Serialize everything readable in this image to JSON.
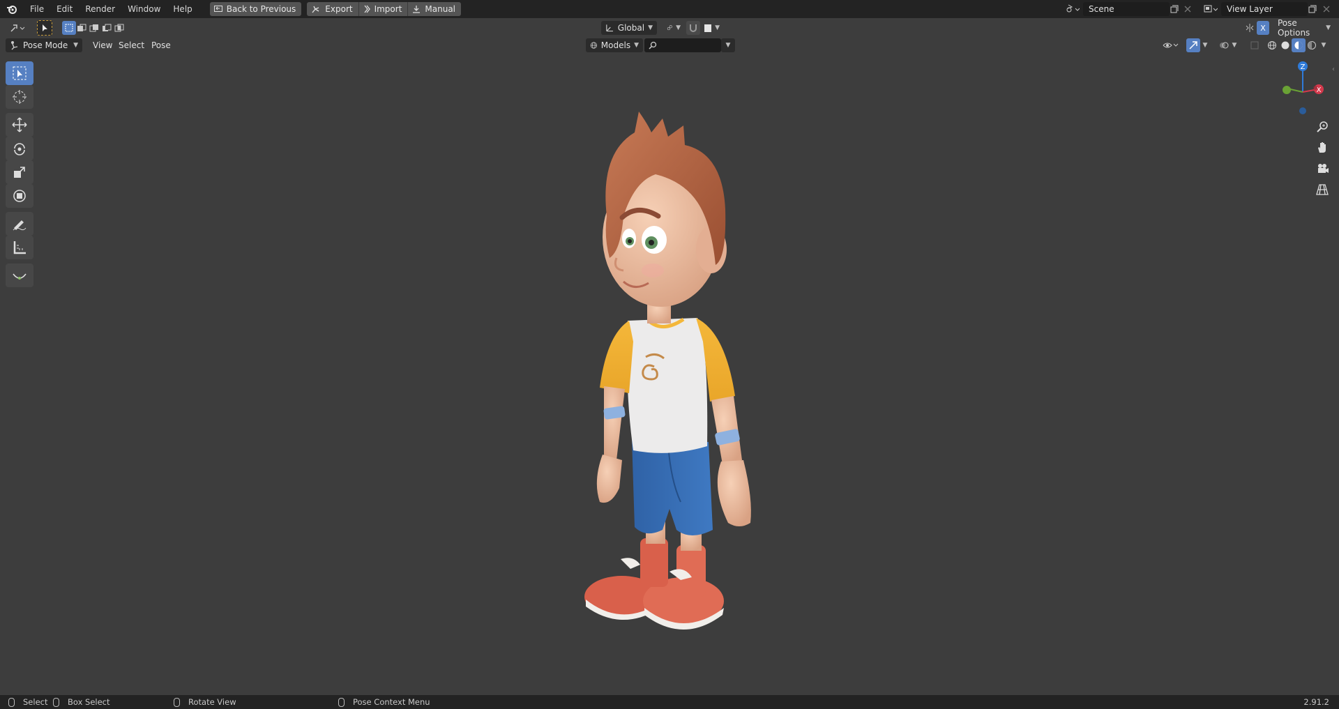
{
  "menu": {
    "items": [
      "File",
      "Edit",
      "Render",
      "Window",
      "Help"
    ],
    "back_label": "Back to Previous",
    "export_label": "Export",
    "import_label": "Import",
    "manual_label": "Manual",
    "scene_value": "Scene",
    "view_layer_value": "View Layer"
  },
  "header2": {
    "transform_orientation": "Global",
    "pose_options_label": "Pose Options",
    "x_mirror_label": "X"
  },
  "header3": {
    "mode": "Pose Mode",
    "view_label": "View",
    "select_label": "Select",
    "pose_label": "Pose",
    "collection_dropdown": "Models",
    "search_placeholder": ""
  },
  "gizmo": {
    "z_label": "Z",
    "x_label": "X"
  },
  "statusbar": {
    "select": "Select",
    "box_select": "Box Select",
    "rotate_view": "Rotate View",
    "context_menu": "Pose Context Menu",
    "version": "2.91.2"
  },
  "colors": {
    "accent": "#5680c2",
    "topbar": "#232323",
    "viewport": "#3d3d3d"
  }
}
